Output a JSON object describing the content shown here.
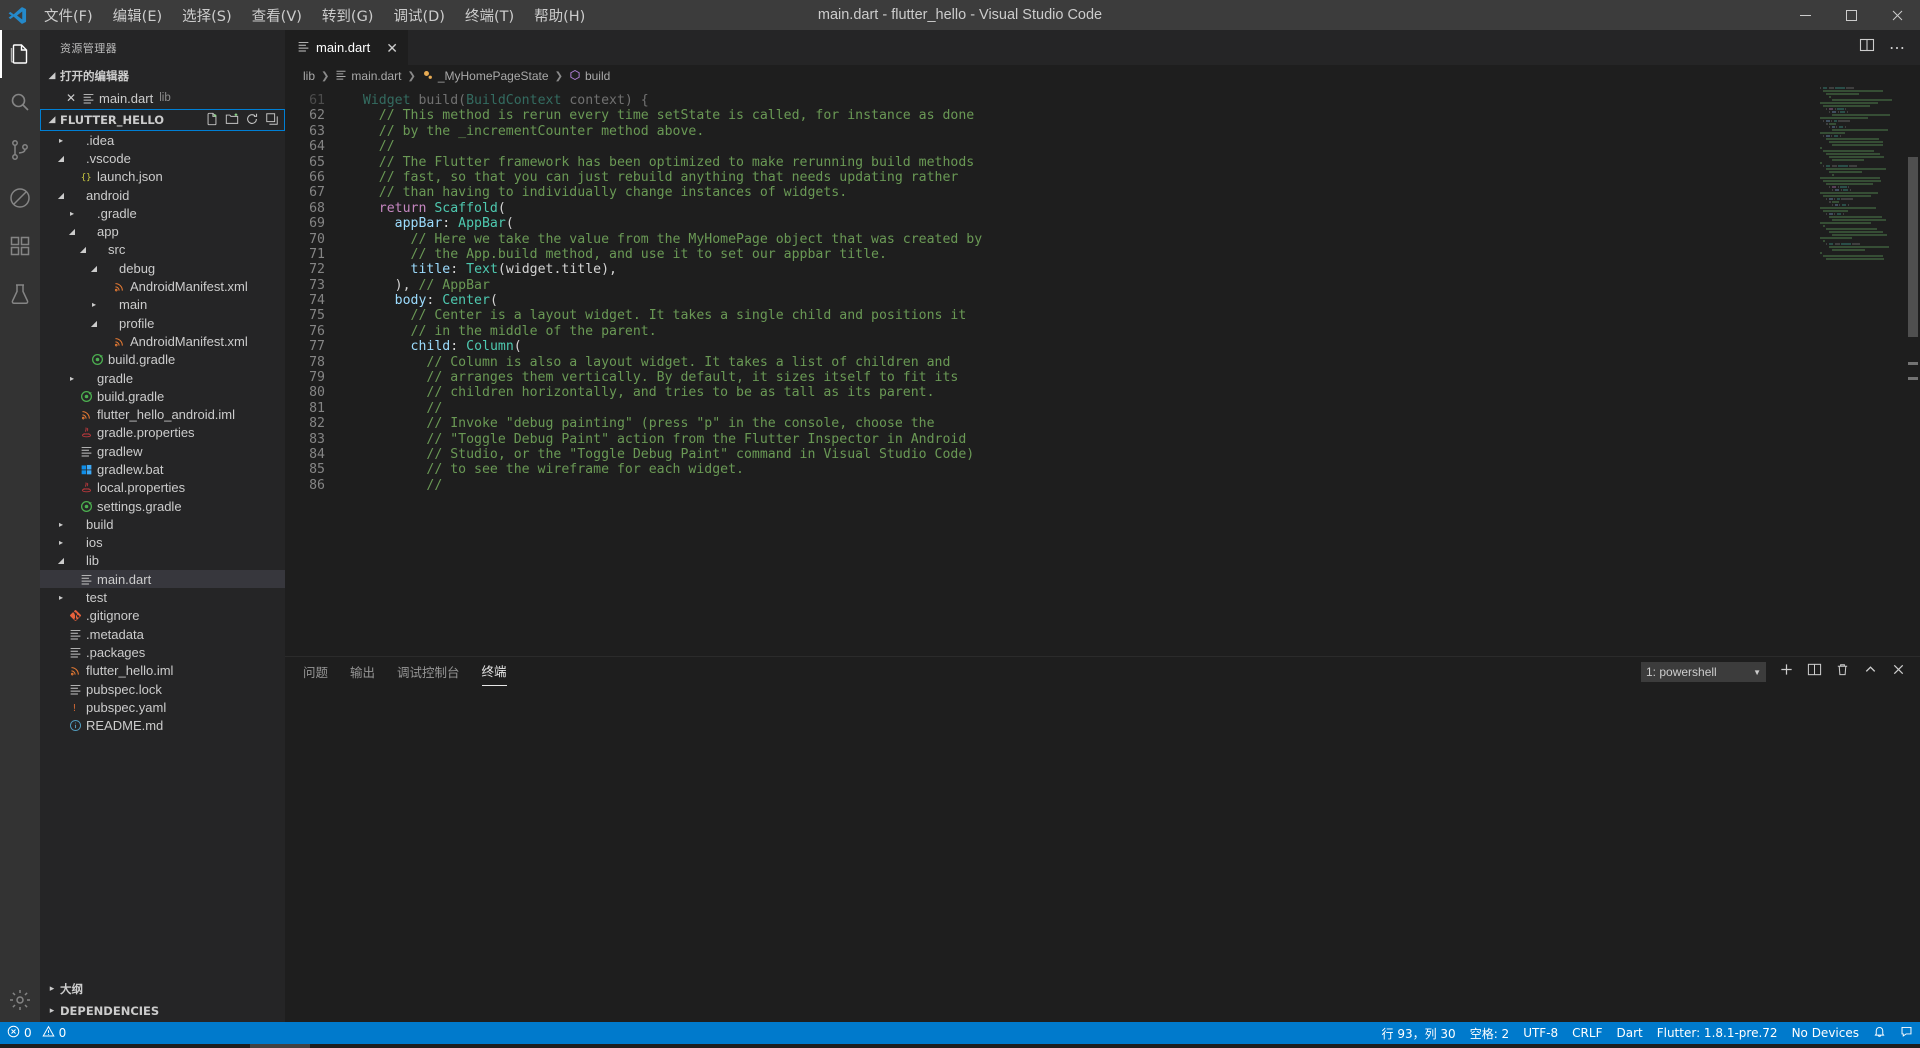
{
  "titlebar": {
    "logo_icon": "vscode-logo",
    "window_title": "main.dart - flutter_hello - Visual Studio Code",
    "menus": [
      {
        "label": "文件(F)",
        "name": "menu-file"
      },
      {
        "label": "编辑(E)",
        "name": "menu-edit"
      },
      {
        "label": "选择(S)",
        "name": "menu-selection"
      },
      {
        "label": "查看(V)",
        "name": "menu-view"
      },
      {
        "label": "转到(G)",
        "name": "menu-go"
      },
      {
        "label": "调试(D)",
        "name": "menu-debug"
      },
      {
        "label": "终端(T)",
        "name": "menu-terminal"
      },
      {
        "label": "帮助(H)",
        "name": "menu-help"
      }
    ],
    "window_controls": {
      "minimize": "minimize-icon",
      "maximize": "maximize-icon",
      "close": "close-icon"
    }
  },
  "activitybar": {
    "items": [
      {
        "name": "activity-explorer",
        "icon": "files-icon",
        "active": true
      },
      {
        "name": "activity-search",
        "icon": "search-icon",
        "active": false
      },
      {
        "name": "activity-source-control",
        "icon": "source-control-icon",
        "active": false
      },
      {
        "name": "activity-debug",
        "icon": "debug-icon",
        "active": false
      },
      {
        "name": "activity-extensions",
        "icon": "extensions-icon",
        "active": false
      },
      {
        "name": "activity-testing",
        "icon": "beaker-icon",
        "active": false
      }
    ],
    "bottom": [
      {
        "name": "activity-settings",
        "icon": "gear-icon"
      }
    ]
  },
  "sidebar": {
    "title": "资源管理器",
    "open_editors": {
      "header": "打开的编辑器",
      "expanded": true,
      "items": [
        {
          "label": "main.dart",
          "sub": "lib",
          "icon": "dart-file-icon",
          "name": "open-editor-main-dart"
        }
      ]
    },
    "project": {
      "header": "FLUTTER_HELLO",
      "actions": [
        "new-file-icon",
        "new-folder-icon",
        "refresh-icon",
        "collapse-all-icon"
      ]
    },
    "tree": [
      {
        "label": ".idea",
        "indent": 1,
        "type": "folder",
        "open": false,
        "icon": "folder-icon"
      },
      {
        "label": ".vscode",
        "indent": 1,
        "type": "folder",
        "open": true,
        "icon": "folder-icon"
      },
      {
        "label": "launch.json",
        "indent": 2,
        "type": "file",
        "icon": "json-icon"
      },
      {
        "label": "android",
        "indent": 1,
        "type": "folder",
        "open": true,
        "icon": "folder-icon"
      },
      {
        "label": ".gradle",
        "indent": 2,
        "type": "folder",
        "open": false,
        "icon": "folder-icon"
      },
      {
        "label": "app",
        "indent": 2,
        "type": "folder",
        "open": true,
        "icon": "folder-icon"
      },
      {
        "label": "src",
        "indent": 3,
        "type": "folder",
        "open": true,
        "icon": "folder-icon"
      },
      {
        "label": "debug",
        "indent": 4,
        "type": "folder",
        "open": true,
        "icon": "folder-icon"
      },
      {
        "label": "AndroidManifest.xml",
        "indent": 5,
        "type": "file",
        "icon": "xml-icon"
      },
      {
        "label": "main",
        "indent": 4,
        "type": "folder",
        "open": false,
        "icon": "folder-icon"
      },
      {
        "label": "profile",
        "indent": 4,
        "type": "folder",
        "open": true,
        "icon": "folder-icon"
      },
      {
        "label": "AndroidManifest.xml",
        "indent": 5,
        "type": "file",
        "icon": "xml-icon"
      },
      {
        "label": "build.gradle",
        "indent": 3,
        "type": "file",
        "icon": "gradle-icon"
      },
      {
        "label": "gradle",
        "indent": 2,
        "type": "folder",
        "open": false,
        "icon": "folder-icon"
      },
      {
        "label": "build.gradle",
        "indent": 2,
        "type": "file",
        "icon": "gradle-icon"
      },
      {
        "label": "flutter_hello_android.iml",
        "indent": 2,
        "type": "file",
        "icon": "xml-icon"
      },
      {
        "label": "gradle.properties",
        "indent": 2,
        "type": "file",
        "icon": "java-icon"
      },
      {
        "label": "gradlew",
        "indent": 2,
        "type": "file",
        "icon": "text-icon"
      },
      {
        "label": "gradlew.bat",
        "indent": 2,
        "type": "file",
        "icon": "windows-icon"
      },
      {
        "label": "local.properties",
        "indent": 2,
        "type": "file",
        "icon": "java-icon"
      },
      {
        "label": "settings.gradle",
        "indent": 2,
        "type": "file",
        "icon": "gradle-icon"
      },
      {
        "label": "build",
        "indent": 1,
        "type": "folder",
        "open": false,
        "icon": "folder-icon"
      },
      {
        "label": "ios",
        "indent": 1,
        "type": "folder",
        "open": false,
        "icon": "folder-icon"
      },
      {
        "label": "lib",
        "indent": 1,
        "type": "folder",
        "open": true,
        "icon": "folder-icon"
      },
      {
        "label": "main.dart",
        "indent": 2,
        "type": "file",
        "icon": "text-icon",
        "selected": true
      },
      {
        "label": "test",
        "indent": 1,
        "type": "folder",
        "open": false,
        "icon": "folder-icon"
      },
      {
        "label": ".gitignore",
        "indent": 1,
        "type": "file",
        "icon": "git-icon"
      },
      {
        "label": ".metadata",
        "indent": 1,
        "type": "file",
        "icon": "text-icon"
      },
      {
        "label": ".packages",
        "indent": 1,
        "type": "file",
        "icon": "text-icon"
      },
      {
        "label": "flutter_hello.iml",
        "indent": 1,
        "type": "file",
        "icon": "xml-icon"
      },
      {
        "label": "pubspec.lock",
        "indent": 1,
        "type": "file",
        "icon": "text-icon"
      },
      {
        "label": "pubspec.yaml",
        "indent": 1,
        "type": "file",
        "icon": "yaml-icon"
      },
      {
        "label": "README.md",
        "indent": 1,
        "type": "file",
        "icon": "markdown-icon"
      }
    ],
    "bottom_sections": [
      {
        "label": "大纲",
        "name": "section-outline"
      },
      {
        "label": "DEPENDENCIES",
        "name": "section-dependencies"
      }
    ]
  },
  "editor": {
    "tabs": [
      {
        "label": "main.dart",
        "icon": "dart-file-icon",
        "active": true,
        "close_icon": "close-icon"
      }
    ],
    "tab_actions": [
      "split-editor-icon",
      "more-actions-icon"
    ],
    "breadcrumbs": [
      {
        "label": "lib",
        "icon": "folder-icon"
      },
      {
        "label": "main.dart",
        "icon": "dart-file-icon"
      },
      {
        "label": "_MyHomePageState",
        "icon": "class-icon"
      },
      {
        "label": "build",
        "icon": "method-icon"
      }
    ],
    "first_line_number": 61,
    "lines": [
      {
        "n": 61,
        "partial": true,
        "tokens": [
          {
            "t": "  ",
            "c": "plain"
          },
          {
            "t": "Widget",
            "c": "type"
          },
          {
            "t": " build(",
            "c": "plain"
          },
          {
            "t": "BuildContext",
            "c": "type"
          },
          {
            "t": " context) {",
            "c": "plain"
          }
        ]
      },
      {
        "n": 62,
        "tokens": [
          {
            "t": "    // This method is rerun every time setState is called, for instance as done",
            "c": "comment"
          }
        ]
      },
      {
        "n": 63,
        "tokens": [
          {
            "t": "    // by the _incrementCounter method above.",
            "c": "comment"
          }
        ]
      },
      {
        "n": 64,
        "tokens": [
          {
            "t": "    //",
            "c": "comment"
          }
        ]
      },
      {
        "n": 65,
        "tokens": [
          {
            "t": "    // The Flutter framework has been optimized to make rerunning build methods",
            "c": "comment"
          }
        ]
      },
      {
        "n": 66,
        "tokens": [
          {
            "t": "    // fast, so that you can just rebuild anything that needs updating rather",
            "c": "comment"
          }
        ]
      },
      {
        "n": 67,
        "tokens": [
          {
            "t": "    // than having to individually change instances of widgets.",
            "c": "comment"
          }
        ]
      },
      {
        "n": 68,
        "tokens": [
          {
            "t": "    ",
            "c": "plain"
          },
          {
            "t": "return",
            "c": "keyword"
          },
          {
            "t": " ",
            "c": "plain"
          },
          {
            "t": "Scaffold",
            "c": "type"
          },
          {
            "t": "(",
            "c": "plain"
          }
        ]
      },
      {
        "n": 69,
        "tokens": [
          {
            "t": "      ",
            "c": "plain"
          },
          {
            "t": "appBar",
            "c": "prop"
          },
          {
            "t": ": ",
            "c": "plain"
          },
          {
            "t": "AppBar",
            "c": "type"
          },
          {
            "t": "(",
            "c": "plain"
          }
        ]
      },
      {
        "n": 70,
        "tokens": [
          {
            "t": "        // Here we take the value from the MyHomePage object that was created by",
            "c": "comment"
          }
        ]
      },
      {
        "n": 71,
        "tokens": [
          {
            "t": "        // the App.build method, and use it to set our appbar title.",
            "c": "comment"
          }
        ]
      },
      {
        "n": 72,
        "tokens": [
          {
            "t": "        ",
            "c": "plain"
          },
          {
            "t": "title",
            "c": "prop"
          },
          {
            "t": ": ",
            "c": "plain"
          },
          {
            "t": "Text",
            "c": "type"
          },
          {
            "t": "(widget.title),",
            "c": "plain"
          }
        ]
      },
      {
        "n": 73,
        "tokens": [
          {
            "t": "      ), ",
            "c": "plain"
          },
          {
            "t": "// AppBar",
            "c": "comment"
          }
        ]
      },
      {
        "n": 74,
        "tokens": [
          {
            "t": "      ",
            "c": "plain"
          },
          {
            "t": "body",
            "c": "prop"
          },
          {
            "t": ": ",
            "c": "plain"
          },
          {
            "t": "Center",
            "c": "type"
          },
          {
            "t": "(",
            "c": "plain"
          }
        ]
      },
      {
        "n": 75,
        "tokens": [
          {
            "t": "        // Center is a layout widget. It takes a single child and positions it",
            "c": "comment"
          }
        ]
      },
      {
        "n": 76,
        "tokens": [
          {
            "t": "        // in the middle of the parent.",
            "c": "comment"
          }
        ]
      },
      {
        "n": 77,
        "tokens": [
          {
            "t": "        ",
            "c": "plain"
          },
          {
            "t": "child",
            "c": "prop"
          },
          {
            "t": ": ",
            "c": "plain"
          },
          {
            "t": "Column",
            "c": "type"
          },
          {
            "t": "(",
            "c": "plain"
          }
        ]
      },
      {
        "n": 78,
        "tokens": [
          {
            "t": "          // Column is also a layout widget. It takes a list of children and",
            "c": "comment"
          }
        ]
      },
      {
        "n": 79,
        "tokens": [
          {
            "t": "          // arranges them vertically. By default, it sizes itself to fit its",
            "c": "comment"
          }
        ]
      },
      {
        "n": 80,
        "tokens": [
          {
            "t": "          // children horizontally, and tries to be as tall as its parent.",
            "c": "comment"
          }
        ]
      },
      {
        "n": 81,
        "tokens": [
          {
            "t": "          //",
            "c": "comment"
          }
        ]
      },
      {
        "n": 82,
        "tokens": [
          {
            "t": "          // Invoke \"debug painting\" (press \"p\" in the console, choose the",
            "c": "comment"
          }
        ]
      },
      {
        "n": 83,
        "tokens": [
          {
            "t": "          // \"Toggle Debug Paint\" action from the Flutter Inspector in Android",
            "c": "comment"
          }
        ]
      },
      {
        "n": 84,
        "tokens": [
          {
            "t": "          // Studio, or the \"Toggle Debug Paint\" command in Visual Studio Code)",
            "c": "comment"
          }
        ]
      },
      {
        "n": 85,
        "tokens": [
          {
            "t": "          // to see the wireframe for each widget.",
            "c": "comment"
          }
        ]
      },
      {
        "n": 86,
        "tokens": [
          {
            "t": "          //",
            "c": "comment"
          }
        ]
      }
    ]
  },
  "panel": {
    "tabs": [
      {
        "label": "问题",
        "name": "panel-tab-problems",
        "active": false
      },
      {
        "label": "输出",
        "name": "panel-tab-output",
        "active": false
      },
      {
        "label": "调试控制台",
        "name": "panel-tab-debug-console",
        "active": false
      },
      {
        "label": "终端",
        "name": "panel-tab-terminal",
        "active": true
      }
    ],
    "terminal_select": {
      "value": "1: powershell",
      "caret_icon": "chevron-down-icon"
    },
    "actions": [
      "new-terminal-icon",
      "split-terminal-icon",
      "kill-terminal-icon",
      "maximize-panel-icon",
      "close-panel-icon"
    ],
    "content": ""
  },
  "statusbar": {
    "left": [
      {
        "label": "0",
        "icon": "error-icon",
        "name": "status-errors"
      },
      {
        "label": "0",
        "icon": "warning-icon",
        "name": "status-warnings"
      }
    ],
    "right": [
      {
        "label": "行 93，列 30",
        "name": "status-cursor-position"
      },
      {
        "label": "空格: 2",
        "name": "status-indentation"
      },
      {
        "label": "UTF-8",
        "name": "status-encoding"
      },
      {
        "label": "CRLF",
        "name": "status-eol"
      },
      {
        "label": "Dart",
        "name": "status-language-mode"
      },
      {
        "label": "Flutter: 1.8.1-pre.72",
        "name": "status-flutter-version"
      },
      {
        "label": "No Devices",
        "name": "status-devices"
      },
      {
        "label": "",
        "icon": "bell-icon",
        "name": "status-notifications"
      },
      {
        "label": "",
        "icon": "feedback-icon",
        "name": "status-feedback"
      }
    ]
  },
  "colors": {
    "accent": "#007acc",
    "titlebar_bg": "#3c3c3c",
    "sidebar_bg": "#252526",
    "editor_bg": "#1e1e1e",
    "activitybar_bg": "#333333",
    "comment": "#6A9955",
    "keyword": "#C586C0",
    "type": "#4EC9B0",
    "property": "#9CDCFE"
  }
}
